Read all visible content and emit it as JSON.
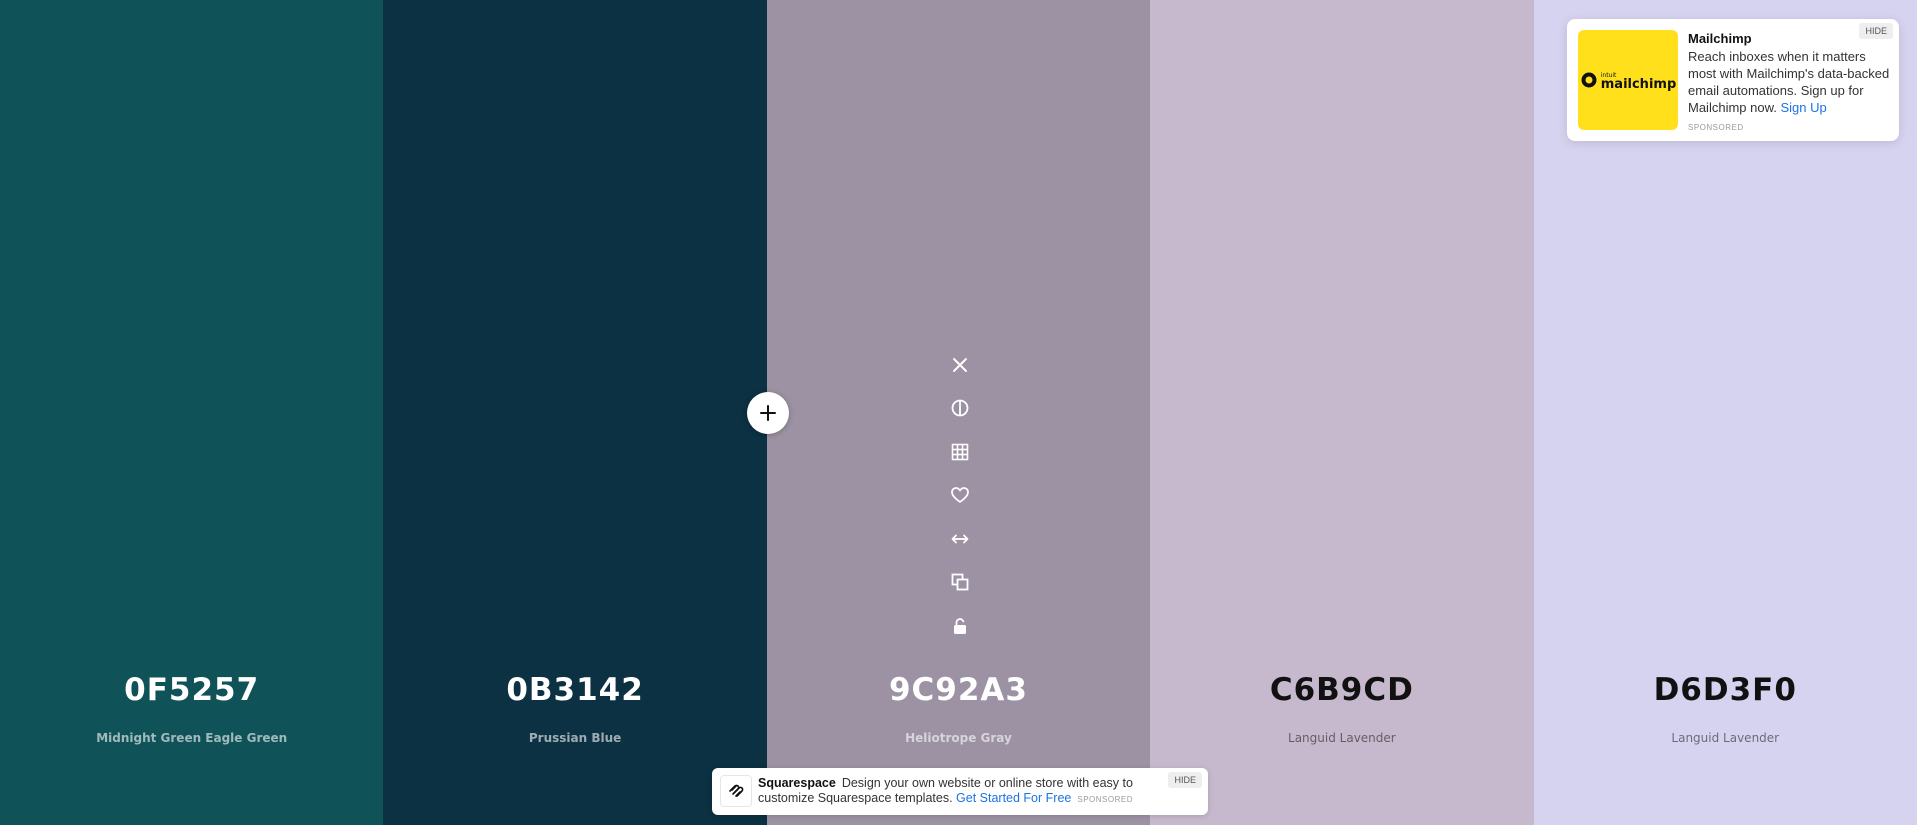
{
  "palette": {
    "colors": [
      {
        "hex": "0F5257",
        "name": "Midnight Green Eagle Green",
        "color": "#0F5257",
        "tone": "dark"
      },
      {
        "hex": "0B3142",
        "name": "Prussian Blue",
        "color": "#0B3142",
        "tone": "dark"
      },
      {
        "hex": "9C92A3",
        "name": "Heliotrope Gray",
        "color": "#9C92A3",
        "tone": "dark"
      },
      {
        "hex": "C6B9CD",
        "name": "Languid Lavender",
        "color": "#C6B9CD",
        "tone": "light"
      },
      {
        "hex": "D6D3F0",
        "name": "Languid Lavender",
        "color": "#D6D3F0",
        "tone": "light"
      }
    ]
  },
  "toolbar": {
    "icons": [
      "close-icon",
      "contrast-icon",
      "shades-grid-icon",
      "heart-icon",
      "drag-arrows-icon",
      "copy-icon",
      "unlock-icon"
    ]
  },
  "add_button": {
    "icon": "plus-icon"
  },
  "ad_card": {
    "title": "Mailchimp",
    "body": "Reach inboxes when it matters most with Mailchimp's data-backed email automations. Sign up for Mailchimp now.",
    "cta": "Sign Up",
    "sponsored": "SPONSORED",
    "hide": "HIDE",
    "logo_small": "intuit",
    "logo_text": "mailchimp",
    "logo_color": "#FFE01B"
  },
  "ad_bar": {
    "brand": "Squarespace",
    "body": "Design your own website or online store with easy to customize Squarespace templates.",
    "cta": "Get Started For Free",
    "sponsored": "SPONSORED",
    "hide": "HIDE"
  }
}
